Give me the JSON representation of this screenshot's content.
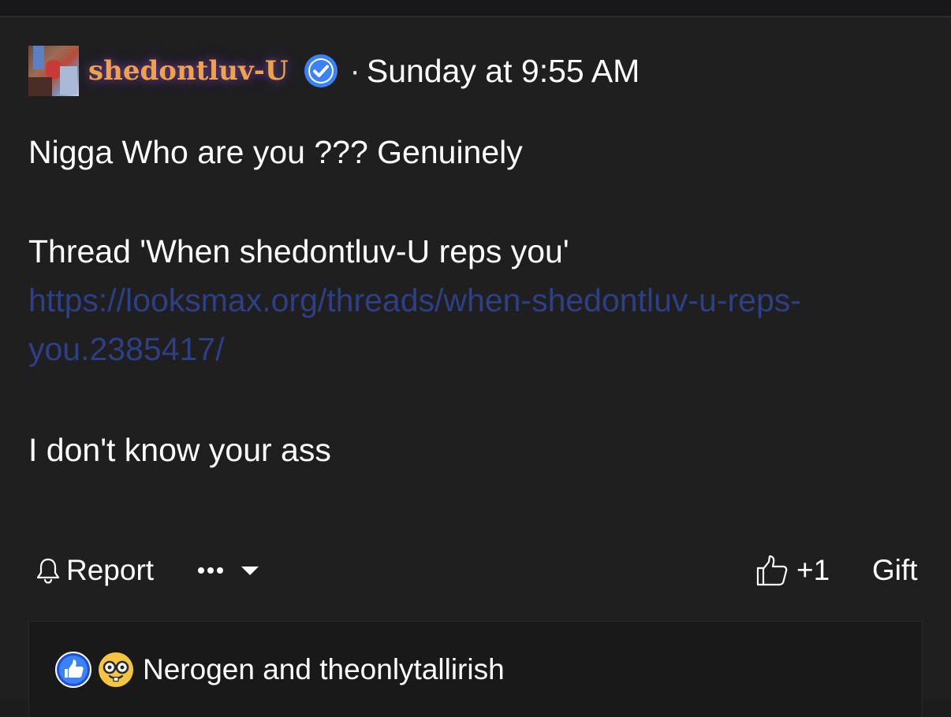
{
  "post": {
    "username": "shedontluv-U",
    "separator": "·",
    "timestamp": "Sunday at 9:55 AM",
    "body": {
      "line1": "Nigga Who are you ??? Genuinely",
      "line2": "Thread 'When shedontluv-U reps you'",
      "link": "https://looksmax.org/threads/when-shedontluv-u-reps-you.2385417/",
      "line3": "I don't know your ass"
    }
  },
  "actions": {
    "report_label": "Report",
    "more_label": "•••",
    "like_count": "+1",
    "gift_label": "Gift"
  },
  "reactions": {
    "text": "Nerogen and theonlytallirish",
    "icons": [
      "like-reaction-icon",
      "nerd-face-reaction-icon"
    ]
  },
  "colors": {
    "background": "#1f1f20",
    "username": "#f0a24a",
    "username_glow": "#8c50c8",
    "verified": "#3b82f6",
    "link": "#2d3f85",
    "text": "#ffffff"
  }
}
